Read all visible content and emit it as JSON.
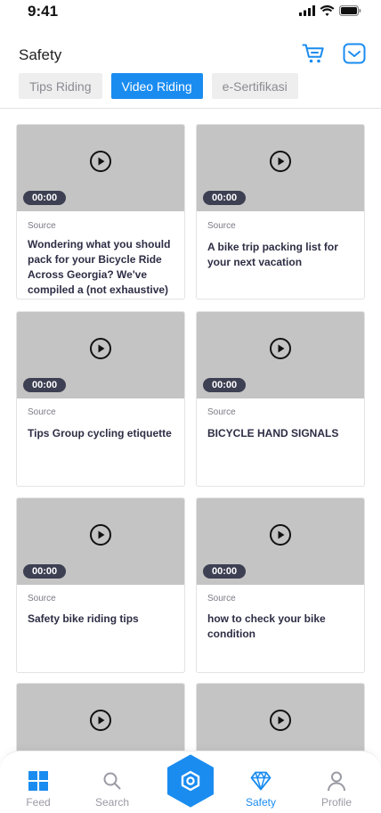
{
  "status_bar": {
    "time": "9:41"
  },
  "header": {
    "title": "Safety",
    "cart_icon": "cart-icon",
    "inbox_icon": "inbox-icon",
    "accent": "#1a8cf0"
  },
  "tabs": [
    {
      "label": "Tips Riding",
      "active": false
    },
    {
      "label": "Video Riding",
      "active": true
    },
    {
      "label": "e-Sertifikasi",
      "active": false
    }
  ],
  "videos": [
    {
      "duration": "00:00",
      "source": "Source",
      "title": "Wondering what you should pack for your Bicycle Ride Across Georgia? We've compiled a (not exhaustive)"
    },
    {
      "duration": "00:00",
      "source": "Source",
      "title": "A bike trip packing list for your next vacation"
    },
    {
      "duration": "00:00",
      "source": "Source",
      "title": "Tips Group cycling etiquette"
    },
    {
      "duration": "00:00",
      "source": "Source",
      "title": "BICYCLE HAND SIGNALS"
    },
    {
      "duration": "00:00",
      "source": "Source",
      "title": "Safety bike riding tips"
    },
    {
      "duration": "00:00",
      "source": "Source",
      "title": "how to check your bike condition"
    },
    {
      "duration": "",
      "source": "",
      "title": ""
    },
    {
      "duration": "",
      "source": "",
      "title": ""
    }
  ],
  "bottom_nav": [
    {
      "label": "Feed",
      "icon": "grid-icon",
      "active": false
    },
    {
      "label": "Search",
      "icon": "search-icon",
      "active": false
    },
    {
      "label": "Safety",
      "icon": "diamond-icon",
      "active": true
    },
    {
      "label": "Profile",
      "icon": "person-icon",
      "active": false
    }
  ],
  "center_action": {
    "icon": "hexagon-center-icon"
  }
}
